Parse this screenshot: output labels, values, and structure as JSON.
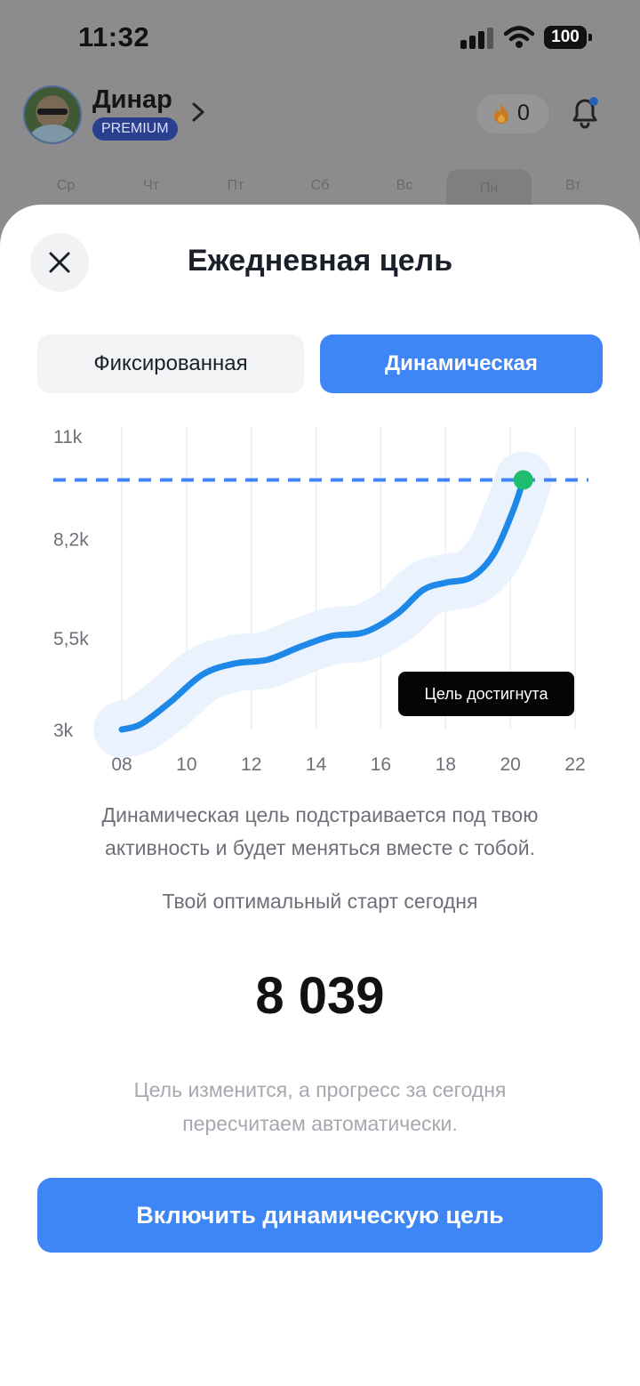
{
  "status_bar": {
    "time": "11:32",
    "battery": "100"
  },
  "header": {
    "user_name": "Динар",
    "badge": "PREMIUM",
    "streak_count": "0"
  },
  "week": {
    "days": [
      "Ср",
      "Чт",
      "Пт",
      "Сб",
      "Вс",
      "Пн",
      "Вт"
    ],
    "current_index": 5
  },
  "sheet": {
    "title": "Ежедневная цель",
    "tabs": {
      "fixed": "Фиксированная",
      "dynamic": "Динамическая",
      "selected": "dynamic"
    },
    "tooltip": "Цель достигнута",
    "description": "Динамическая цель подстраивается под твою активность и будет меняться вместе с тобой.",
    "start_label": "Твой оптимальный старт сегодня",
    "start_value": "8 039",
    "note": "Цель изменится, а прогресс за сегодня пересчитаем автоматически.",
    "cta": "Включить динамическую цель"
  },
  "colors": {
    "accent": "#3e86f5",
    "goal_dot": "#1fbd6e",
    "line": "#1e88e8",
    "band": "#e6f1fd"
  },
  "chart_data": {
    "type": "line",
    "y_tick_labels": [
      "11k",
      "8,2k",
      "5,5k",
      "3k"
    ],
    "y_ticks": [
      11000,
      8200,
      5500,
      3000
    ],
    "x_tick_labels": [
      "08",
      "10",
      "12",
      "14",
      "16",
      "18",
      "20",
      "22"
    ],
    "x_ticks": [
      8,
      10,
      12,
      14,
      16,
      18,
      20,
      22
    ],
    "xlim": [
      8,
      22
    ],
    "ylim": [
      3000,
      11000
    ],
    "goal_line": 9800,
    "series": [
      {
        "x": [
          8,
          8.6,
          9.5,
          10.5,
          11.5,
          12.5,
          13.5,
          14.5,
          15.5,
          16.5,
          17.3,
          18,
          18.8,
          19.5,
          20.1,
          20.4
        ],
        "y": [
          3000,
          3150,
          3750,
          4500,
          4800,
          4900,
          5250,
          5550,
          5650,
          6150,
          6800,
          7000,
          7150,
          7800,
          9000,
          9800
        ]
      }
    ],
    "goal_point": {
      "x": 20.4,
      "y": 9800
    },
    "grid": "vertical"
  }
}
